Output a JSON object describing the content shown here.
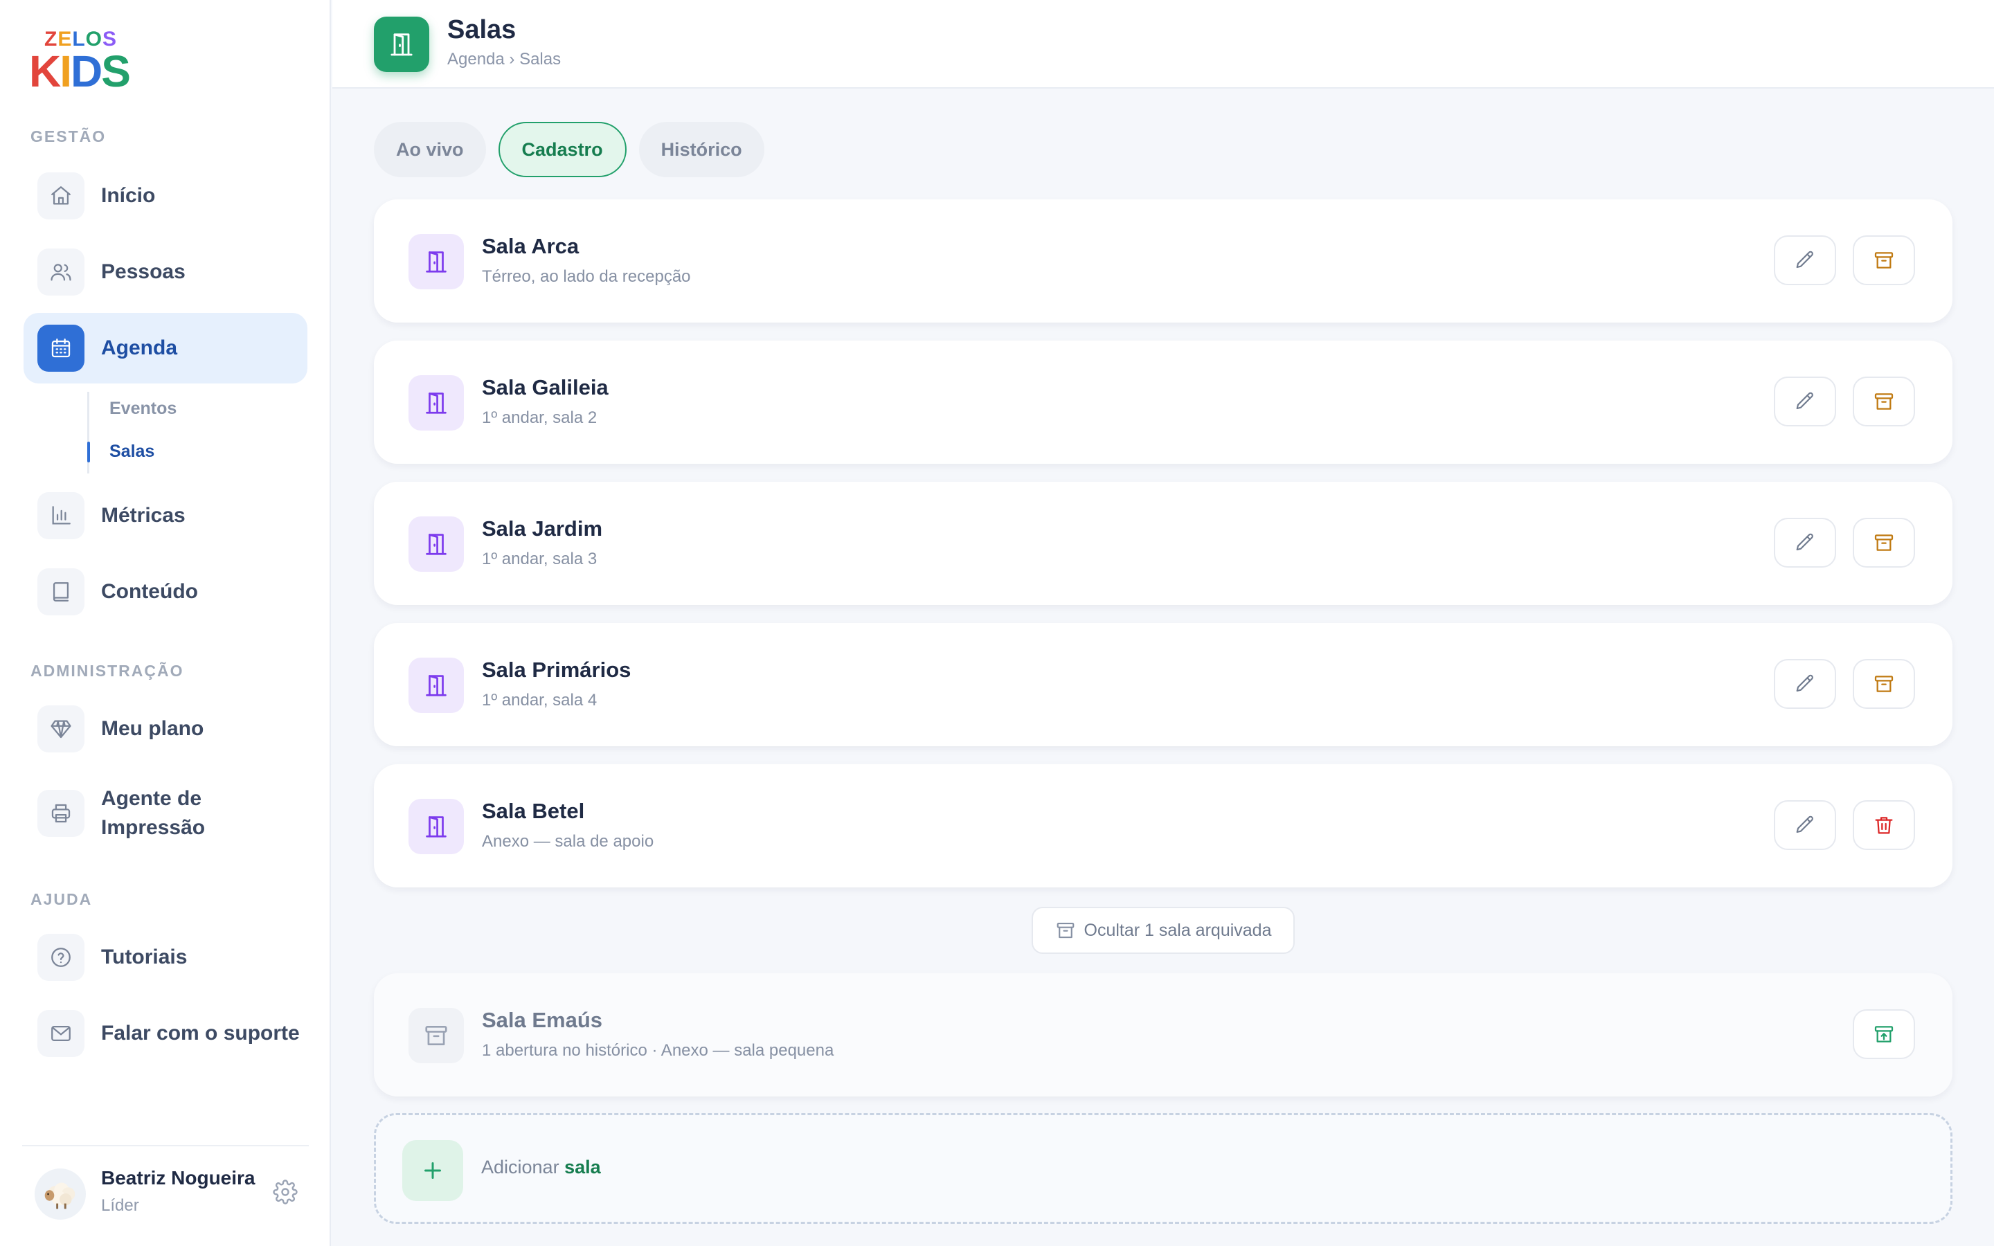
{
  "brand": {
    "line1": "ZELOS",
    "line2": "KIDS"
  },
  "sidebar": {
    "sections": {
      "gestao": "GESTÃO",
      "admin": "ADMINISTRAÇÃO",
      "ajuda": "AJUDA"
    },
    "items": {
      "inicio": "Início",
      "pessoas": "Pessoas",
      "agenda": "Agenda",
      "metricas": "Métricas",
      "conteudo": "Conteúdo",
      "plano": "Meu plano",
      "impressao_1": "Agente de",
      "impressao_2": "Impressão",
      "tutoriais": "Tutoriais",
      "suporte": "Falar com o suporte"
    },
    "subitems": {
      "eventos": "Eventos",
      "salas": "Salas"
    }
  },
  "user": {
    "name": "Beatriz Nogueira",
    "role": "Líder"
  },
  "header": {
    "title": "Salas",
    "breadcrumb": "Agenda › Salas"
  },
  "tabs": {
    "ao_vivo": "Ao vivo",
    "cadastro": "Cadastro",
    "historico": "Histórico"
  },
  "rooms": [
    {
      "name": "Sala Arca",
      "desc": "Térreo, ao lado da recepção"
    },
    {
      "name": "Sala Galileia",
      "desc": "1º andar, sala 2"
    },
    {
      "name": "Sala Jardim",
      "desc": "1º andar, sala 3"
    },
    {
      "name": "Sala Primários",
      "desc": "1º andar, sala 4"
    },
    {
      "name": "Sala Betel",
      "desc": "Anexo — sala de apoio"
    }
  ],
  "archived_toggle": "Ocultar 1 sala arquivada",
  "archived_room": {
    "name": "Sala Emaús",
    "desc": "1 abertura no histórico · Anexo — sala pequena"
  },
  "add": {
    "prefix": "Adicionar",
    "emphasis": "sala"
  },
  "colors": {
    "accent_green": "#22a06b",
    "accent_blue": "#2f6fd6",
    "room_icon": "#7c3aed",
    "archive_orange": "#c07a12",
    "delete_red": "#dc2626"
  }
}
